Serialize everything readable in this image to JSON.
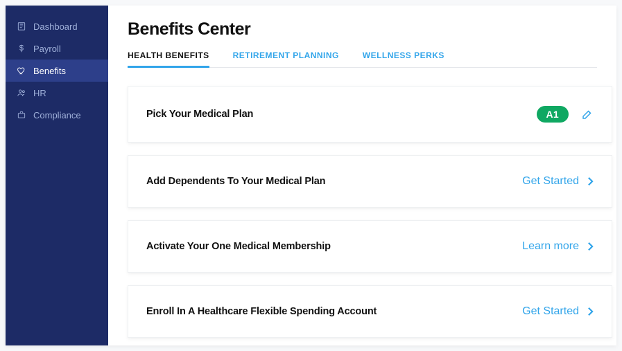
{
  "sidebar": {
    "items": [
      {
        "label": "Dashboard",
        "icon": "dashboard-icon",
        "active": false
      },
      {
        "label": "Payroll",
        "icon": "dollar-icon",
        "active": false
      },
      {
        "label": "Benefits",
        "icon": "heart-icon",
        "active": true
      },
      {
        "label": "HR",
        "icon": "people-icon",
        "active": false
      },
      {
        "label": "Compliance",
        "icon": "briefcase-icon",
        "active": false
      }
    ]
  },
  "header": {
    "title": "Benefits Center"
  },
  "tabs": [
    {
      "label": "HEALTH BENEFITS",
      "active": true
    },
    {
      "label": "RETIREMENT PLANNING",
      "active": false
    },
    {
      "label": "WELLNESS PERKS",
      "active": false
    }
  ],
  "cards": [
    {
      "title": "Pick Your Medical Plan",
      "badge": "A1",
      "action": null,
      "editable": true
    },
    {
      "title": "Add Dependents To Your Medical Plan",
      "badge": null,
      "action": "Get Started",
      "editable": false
    },
    {
      "title": "Activate Your One Medical Membership",
      "badge": null,
      "action": "Learn more",
      "editable": false
    },
    {
      "title": "Enroll In A Healthcare Flexible Spending Account",
      "badge": null,
      "action": "Get Started",
      "editable": false
    }
  ],
  "colors": {
    "sidebar_bg": "#1d2b66",
    "sidebar_active_bg": "#2d3f8a",
    "accent": "#32a5ea",
    "badge_bg": "#0fa862"
  }
}
